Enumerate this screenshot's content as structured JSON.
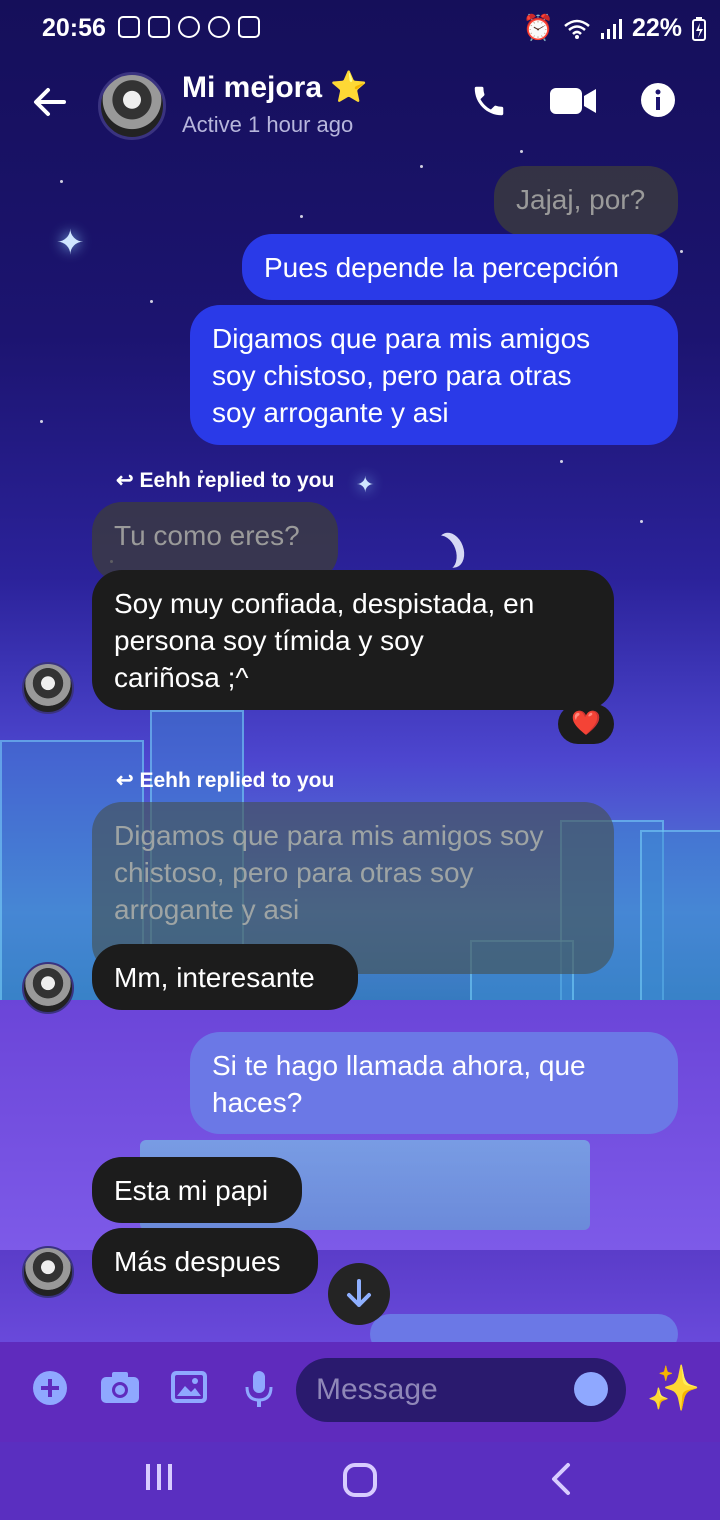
{
  "status_bar": {
    "time": "20:56",
    "battery": "22%"
  },
  "header": {
    "back_icon": "arrow-left-icon",
    "name": "Mi mejora",
    "name_emoji": "⭐",
    "status": "Active 1 hour ago"
  },
  "messages": {
    "m1": "Jajaj, por?",
    "m2": "Pues depende la percepción",
    "m3": "Digamos que para mis amigos\nsoy chistoso, pero para otras\nsoy arrogante y asi",
    "reply1_label": "Eehh replied to you",
    "m4_quote": "Tu como eres?",
    "m4": "Soy muy confiada, despistada, en\npersona soy tímida y soy\ncariñosa ;^",
    "reaction": "❤️",
    "reply2_label": "Eehh replied to you",
    "m5_quote": "Digamos que para mis amigos soy\nchistoso, pero para otras soy\narrogante y asi",
    "m5": "Mm, interesante",
    "m6": "Si te hago llamada ahora, que\nhaces?",
    "m7": "Esta mi papi",
    "m8": "Más despues"
  },
  "composer": {
    "placeholder": "Message"
  },
  "colors": {
    "outgoing": "#2a3ae8",
    "outgoing_light": "#6b78e6",
    "incoming": "#1c1c1c",
    "bar": "#5f2bbd"
  }
}
